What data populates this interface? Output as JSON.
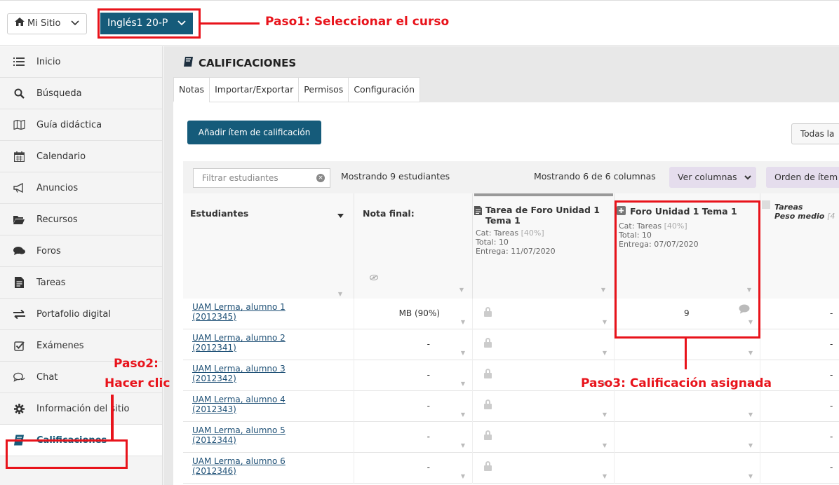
{
  "topbar": {
    "site_label": "Mi Sitio",
    "course_label": "Inglés1 20-P"
  },
  "sidebar": {
    "items": [
      {
        "label": "Inicio",
        "icon": "list-icon"
      },
      {
        "label": "Búsqueda",
        "icon": "search-icon"
      },
      {
        "label": "Guía didáctica",
        "icon": "map-icon"
      },
      {
        "label": "Calendario",
        "icon": "calendar-icon"
      },
      {
        "label": "Anuncios",
        "icon": "megaphone-icon"
      },
      {
        "label": "Recursos",
        "icon": "folder-icon"
      },
      {
        "label": "Foros",
        "icon": "comments-icon"
      },
      {
        "label": "Tareas",
        "icon": "file-icon"
      },
      {
        "label": "Portafolio digital",
        "icon": "exchange-icon"
      },
      {
        "label": "Exámenes",
        "icon": "checkbox-icon"
      },
      {
        "label": "Chat",
        "icon": "chat-icon"
      },
      {
        "label": "Información del sitio",
        "icon": "gear-icon"
      },
      {
        "label": "Calificaciones",
        "icon": "book-icon",
        "active": true
      }
    ]
  },
  "main": {
    "title": "CALIFICACIONES",
    "tabs": [
      "Notas",
      "Importar/Exportar",
      "Permisos",
      "Configuración"
    ],
    "add_button": "Añadir ítem de calificación",
    "todas_button": "Todas la",
    "filter_placeholder": "Filtrar estudiantes",
    "showing_students": "Mostrando 9 estudiantes",
    "showing_columns": "Mostrando 6 de 6 columnas",
    "ver_columnas": "Ver columnas",
    "orden": "Orden de ítem"
  },
  "table": {
    "headers": {
      "students": "Estudiantes",
      "final": "Nota final:",
      "col1_title": "Tarea de Foro Unidad 1 Tema 1",
      "col1_cat": "Cat: Tareas",
      "col1_weight": "[40%]",
      "col1_total": "Total: 10",
      "col1_due": "Entrega: 11/07/2020",
      "col2_title": "Foro Unidad 1 Tema 1",
      "col2_cat": "Cat: Tareas",
      "col2_weight": "[40%]",
      "col2_total": "Total: 10",
      "col2_due": "Entrega: 07/07/2020",
      "col3_title": "Tareas",
      "col3_sub": "Peso medio"
    },
    "rows": [
      {
        "name": "UAM Lerma, alumno 1",
        "id": "(2012345)",
        "final": "MB (90%)",
        "grade": "9",
        "last": "-"
      },
      {
        "name": "UAM Lerma, alumno 2",
        "id": "(2012341)",
        "final": "-",
        "grade": "",
        "last": "-"
      },
      {
        "name": "UAM Lerma, alumno 3",
        "id": "(2012342)",
        "final": "-",
        "grade": "",
        "last": "-"
      },
      {
        "name": "UAM Lerma, alumno 4",
        "id": "(2012343)",
        "final": "-",
        "grade": "",
        "last": "-"
      },
      {
        "name": "UAM Lerma, alumno 5",
        "id": "(2012344)",
        "final": "-",
        "grade": "",
        "last": "-"
      },
      {
        "name": "UAM Lerma, alumno 6",
        "id": "(2012346)",
        "final": "-",
        "grade": "",
        "last": "-"
      }
    ]
  },
  "annotations": {
    "step1": "Paso1: Seleccionar el curso",
    "step2_line1": "Paso2:",
    "step2_line2": "Hacer clic",
    "step3": "Paso3: Calificación asignada"
  },
  "colors": {
    "accent": "#155b7a",
    "annotation": "#e8131b",
    "link": "#1d4f75"
  }
}
